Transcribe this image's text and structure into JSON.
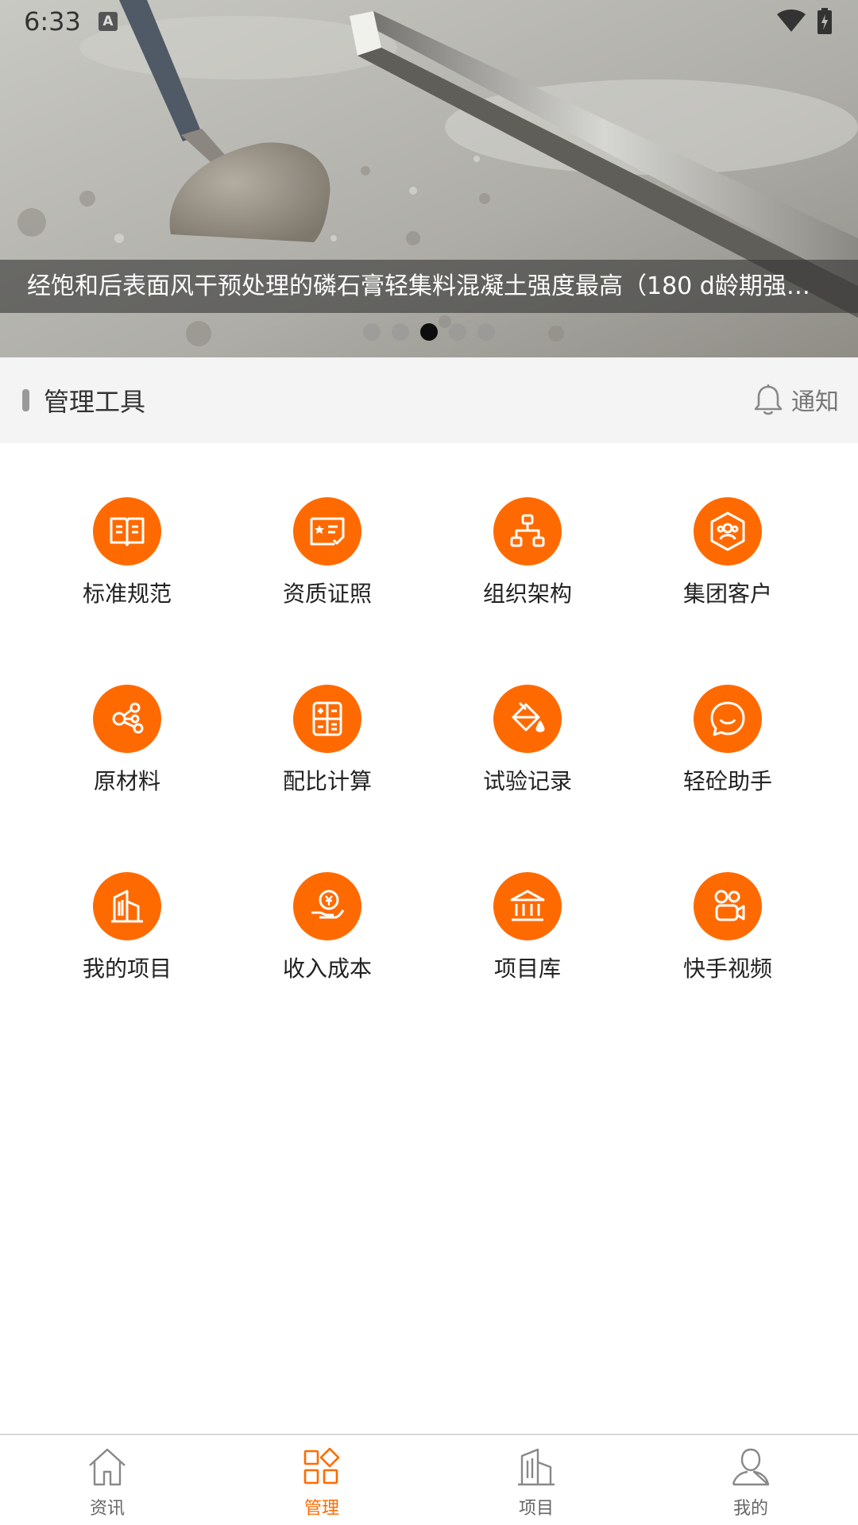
{
  "status_bar": {
    "time": "6:33",
    "indicator": "A"
  },
  "banner": {
    "caption": "经饱和后表面风干预处理的磷石膏轻集料混凝土强度最高（180 d龄期强…",
    "slide_count": 5,
    "active_slide": 3
  },
  "section": {
    "title": "管理工具",
    "notify_label": "通知"
  },
  "tools": [
    {
      "label": "标准规范",
      "icon": "book-icon"
    },
    {
      "label": "资质证照",
      "icon": "certificate-icon"
    },
    {
      "label": "组织架构",
      "icon": "org-chart-icon"
    },
    {
      "label": "集团客户",
      "icon": "group-clients-icon"
    },
    {
      "label": "原材料",
      "icon": "raw-material-icon"
    },
    {
      "label": "配比计算",
      "icon": "calculator-icon"
    },
    {
      "label": "试验记录",
      "icon": "paint-bucket-icon"
    },
    {
      "label": "轻砼助手",
      "icon": "chat-smile-icon"
    },
    {
      "label": "我的项目",
      "icon": "building-icon"
    },
    {
      "label": "收入成本",
      "icon": "coin-hand-icon"
    },
    {
      "label": "项目库",
      "icon": "bank-icon"
    },
    {
      "label": "快手视频",
      "icon": "video-camera-icon"
    }
  ],
  "bottom_nav": {
    "items": [
      {
        "label": "资讯",
        "icon": "home-icon"
      },
      {
        "label": "管理",
        "icon": "grid-icon"
      },
      {
        "label": "项目",
        "icon": "building-icon"
      },
      {
        "label": "我的",
        "icon": "person-icon"
      }
    ],
    "active_index": 1
  },
  "colors": {
    "accent": "#ff6a00",
    "section_bg": "#f4f4f4",
    "caption_bg": "#37373a"
  }
}
